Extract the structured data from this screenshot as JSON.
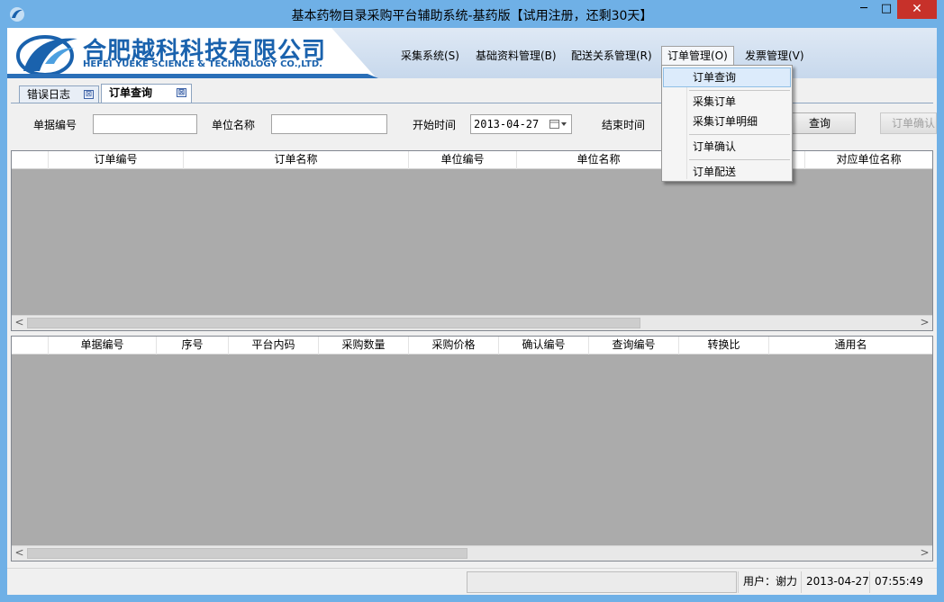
{
  "window": {
    "title": "基本药物目录采购平台辅助系统-基药版【试用注册，还剩30天】",
    "minimize_glyph": "─",
    "maximize_glyph": "□",
    "close_glyph": "✕"
  },
  "banner": {
    "company_cn": "合肥越科科技有限公司",
    "company_en": "HEFEI YUEKE SCIENCE & TECHNOLOGY CO.,LTD."
  },
  "menu": {
    "items": [
      {
        "label": "采集系统(S)"
      },
      {
        "label": "基础资料管理(B)"
      },
      {
        "label": "配送关系管理(R)"
      },
      {
        "label": "订单管理(O)"
      },
      {
        "label": "发票管理(V)"
      }
    ],
    "dropdown": [
      {
        "label": "订单查询"
      },
      {
        "label": "采集订单"
      },
      {
        "label": "采集订单明细"
      },
      {
        "label": "订单确认"
      },
      {
        "label": "订单配送"
      }
    ]
  },
  "tabs": [
    {
      "label": "错误日志",
      "close": "⊠"
    },
    {
      "label": "订单查询",
      "close": "⊠"
    }
  ],
  "search": {
    "doc_no_label": "单据编号",
    "doc_no_value": "",
    "unit_name_label": "单位名称",
    "unit_name_value": "",
    "start_label": "开始时间",
    "start_value": "2013-04-27",
    "end_label": "结束时间",
    "query_button": "查询",
    "confirm_button": "订单确认"
  },
  "grid_top": {
    "columns": [
      "订单编号",
      "订单名称",
      "单位编号",
      "单位名称",
      "对应单位名称"
    ]
  },
  "grid_bottom": {
    "columns": [
      "单据编号",
      "序号",
      "平台内码",
      "采购数量",
      "采购价格",
      "确认编号",
      "查询编号",
      "转换比",
      "通用名"
    ]
  },
  "scroll": {
    "left": "<",
    "right": ">"
  },
  "status": {
    "user": "用户：谢力",
    "date": "2013-04-27",
    "time": "07:55:49"
  },
  "colors": {
    "titlebar": "#6fb0e6",
    "close_button": "#c7312a",
    "brand_blue": "#1a62ad",
    "grid_body": "#ababab"
  }
}
